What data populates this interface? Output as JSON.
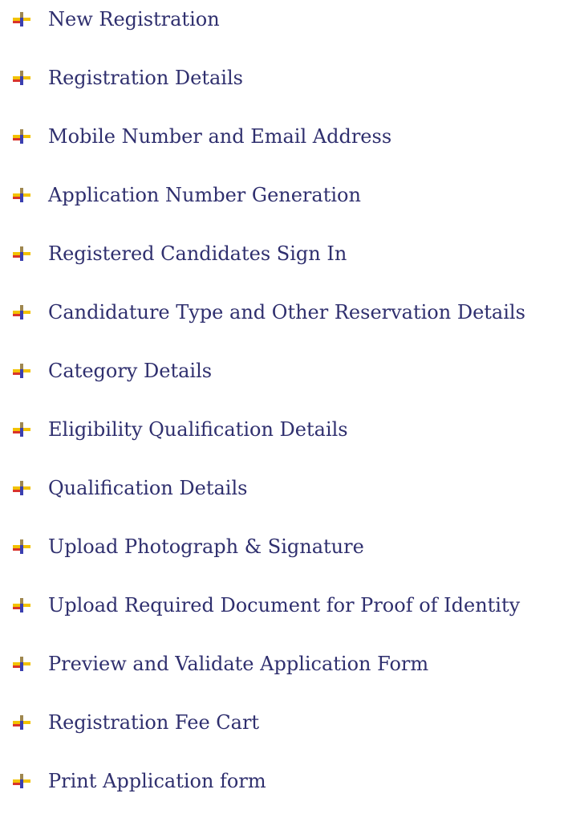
{
  "bullet_icon": "pushpin-plus-bullet-icon",
  "colors": {
    "text": "#2f2f6e",
    "bullet_yellow": "#f2c200",
    "bullet_red": "#d9342b",
    "bullet_blue": "#3a3fb0"
  },
  "steps": [
    {
      "label": "New Registration"
    },
    {
      "label": "Registration Details"
    },
    {
      "label": "Mobile Number and Email Address"
    },
    {
      "label": "Application Number Generation"
    },
    {
      "label": "Registered Candidates Sign In"
    },
    {
      "label": "Candidature Type and Other Reservation Details"
    },
    {
      "label": "Category Details"
    },
    {
      "label": "Eligibility Qualification Details"
    },
    {
      "label": "Qualification Details"
    },
    {
      "label": "Upload Photograph & Signature"
    },
    {
      "label": "Upload Required Document for Proof of Identity"
    },
    {
      "label": "Preview and Validate Application Form"
    },
    {
      "label": "Registration Fee Cart"
    },
    {
      "label": "Print Application form"
    }
  ]
}
